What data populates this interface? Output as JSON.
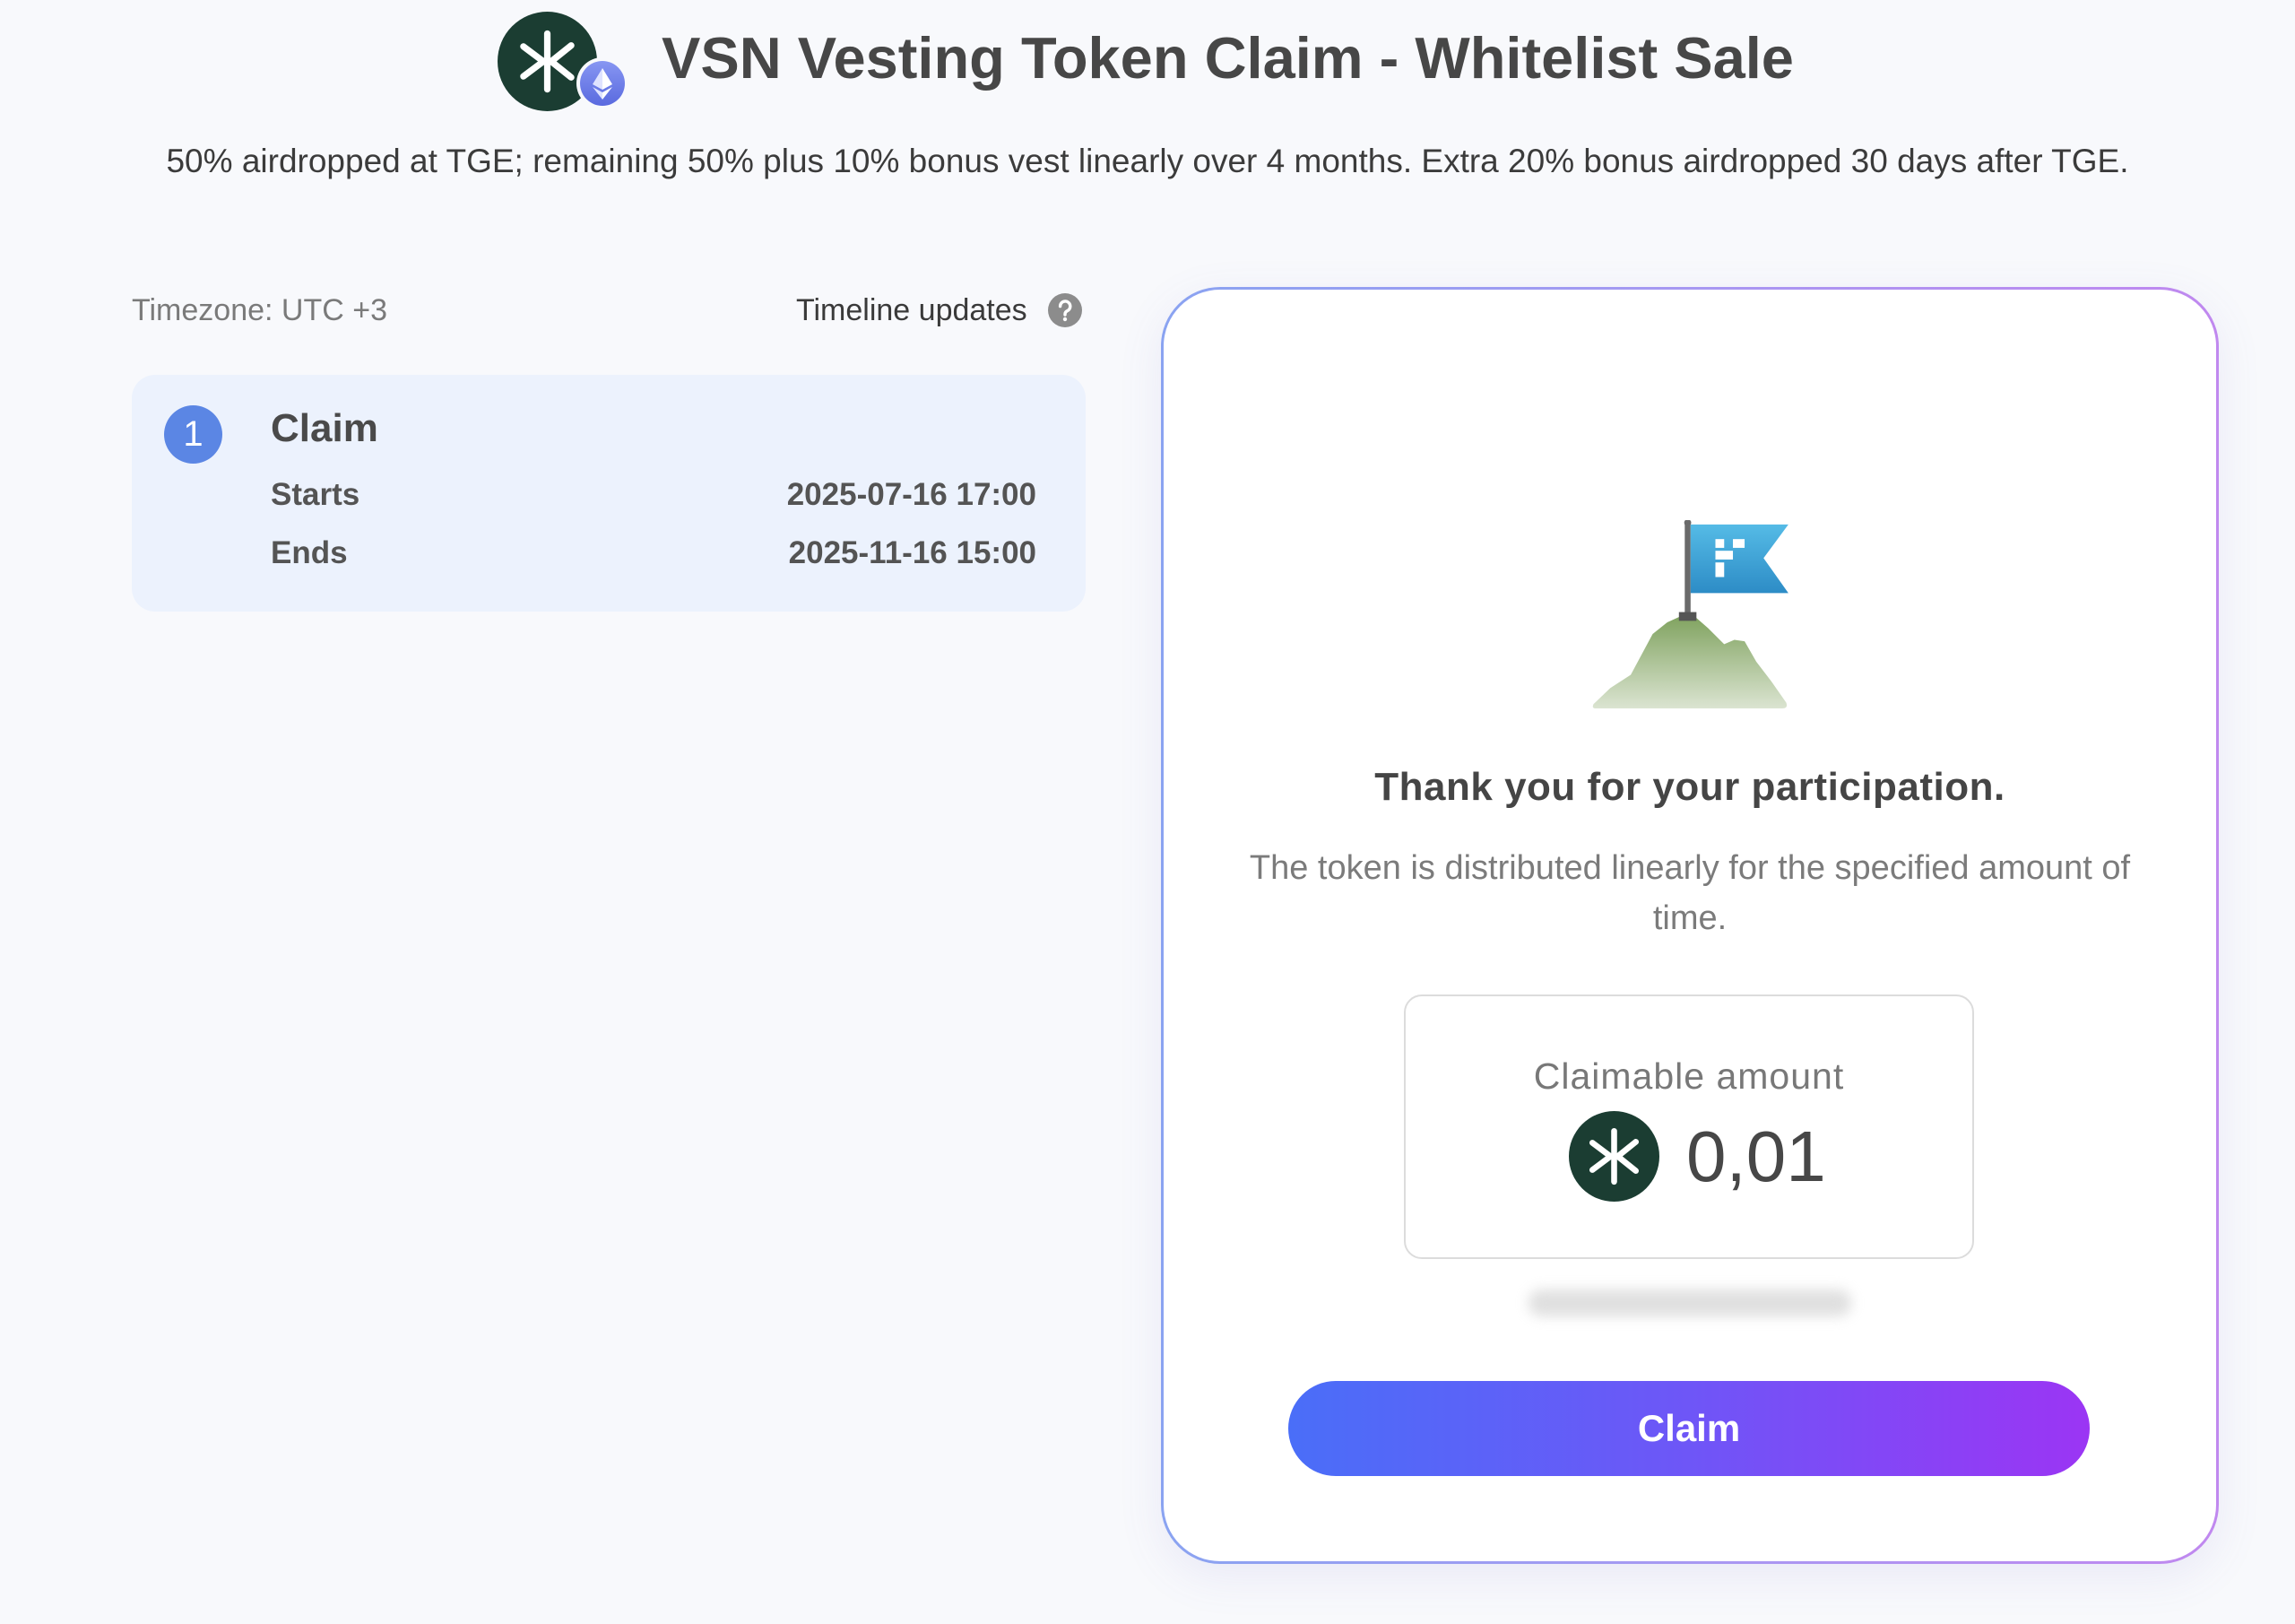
{
  "header": {
    "title": "VSN Vesting Token Claim - Whitelist Sale",
    "subtitle": "50% airdropped at TGE; remaining 50% plus 10% bonus vest linearly over 4 months. Extra 20% bonus airdropped 30 days after TGE.",
    "logo_icon": "vsn-token-icon",
    "network_badge_icon": "ethereum-icon"
  },
  "timeline": {
    "timezone": "Timezone: UTC +3",
    "updates_label": "Timeline updates",
    "help_icon": "question-circle-icon",
    "steps": [
      {
        "number": "1",
        "title": "Claim",
        "rows": [
          {
            "label": "Starts",
            "value": "2025-07-16 17:00"
          },
          {
            "label": "Ends",
            "value": "2025-11-16 15:00"
          }
        ]
      }
    ]
  },
  "claim_panel": {
    "illustration_icon": "mountain-flag-illustration",
    "heading": "Thank you for your participation.",
    "description": "The token is distributed linearly for the specified amount of time.",
    "claimable": {
      "label": "Claimable amount",
      "token_icon": "vsn-token-icon",
      "amount": "0,01"
    },
    "button_label": "Claim"
  },
  "colors": {
    "page_background": "#f8f9fc",
    "step_card_background": "#ecf2fd",
    "step_badge": "#5b86e4",
    "token": "#1b3d32",
    "card_border_start": "#8aa3f1",
    "card_border_end": "#c088ef",
    "button_start": "#4a6ef8",
    "button_end": "#9b35f4"
  }
}
